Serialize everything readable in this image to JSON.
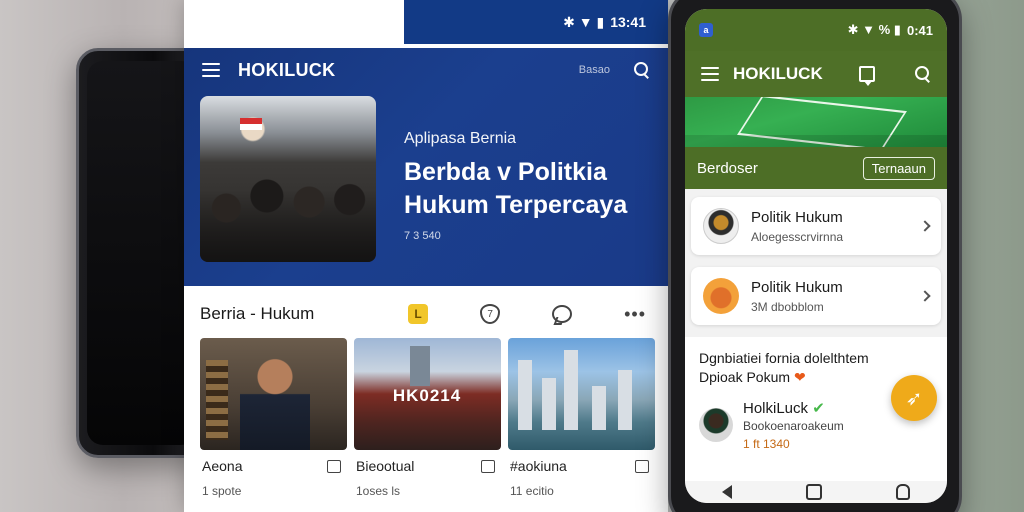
{
  "tablet": {
    "status_time": "13:41",
    "status_icons": "✱ ▼ ▮",
    "app_title": "HOKILUCK",
    "appbar_small": "Basao",
    "hero": {
      "eyebrow": "Aplipasa Bernia",
      "headline": "Berbda v Politkia Hukum Terpercaya",
      "meta": "7 3 540"
    },
    "section_title": "Berria - Hukum",
    "tag_icon_glyph": "L",
    "shield_icon_glyph": "7",
    "more_glyph": "•••",
    "cards": [
      {
        "title": "Aeona",
        "meta": "1 spote"
      },
      {
        "title": "Bieootual",
        "meta": "1oses ls"
      },
      {
        "title": "#aokiuna",
        "meta": "11 ecitio"
      }
    ],
    "card2_sign": "HK0214"
  },
  "phone": {
    "status_time": "0:41",
    "status_icons": "✱ ▼ % ▮",
    "tab_icon_glyph": "a",
    "app_title": "HOKILUCK",
    "banner": {
      "title": "Berdoser",
      "button": "Ternaaun"
    },
    "items": [
      {
        "title": "Politik Hukum",
        "sub": "Aloegesscrvirnna"
      },
      {
        "title": "Politik Hukum",
        "sub": "3M dbobblom"
      }
    ],
    "post": {
      "headline": "Dgnbiatiei fornia dolelthtem Dpioak Pokum",
      "heart": "❤",
      "author": "HolkiLuck",
      "check": "✔",
      "author_sub": "Bookoenaroakeum",
      "time": "1 ft 1340"
    },
    "fab_glyph": "➶"
  }
}
